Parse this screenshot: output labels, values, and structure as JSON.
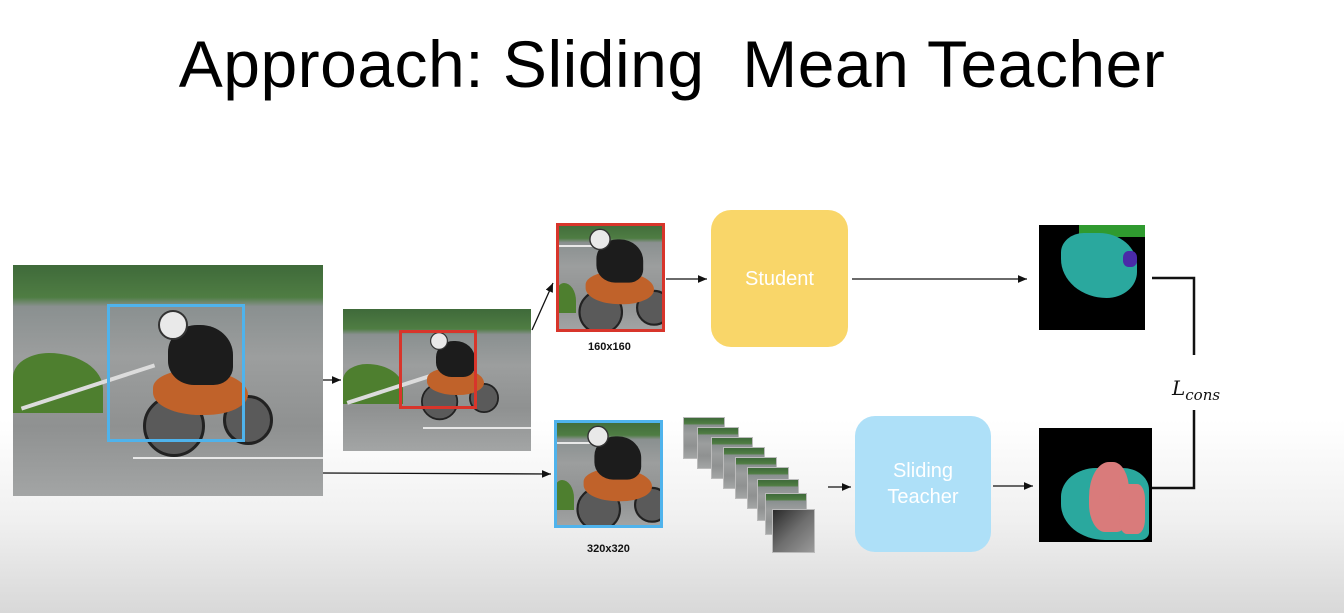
{
  "title": "Approach: Sliding  Mean Teacher",
  "student_label": "Student",
  "teacher_label": "Sliding\nTeacher",
  "crop_small_caption": "160x160",
  "crop_large_caption": "320x320",
  "loss_symbol": "L",
  "loss_subscript": "cons",
  "colors": {
    "student_box": "#f9d669",
    "teacher_box": "#aee0f8",
    "crop_small_frame": "#d8352b",
    "crop_large_frame": "#4fb3ec"
  }
}
